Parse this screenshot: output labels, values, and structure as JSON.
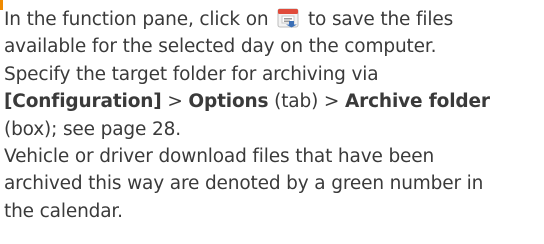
{
  "paragraph1": {
    "line1_before_icon": "In the function pane, click on",
    "icon": "archive-save-icon",
    "line1_after_icon": "to save the files",
    "line2": "available for the selected day on the computer."
  },
  "paragraph2": {
    "line1": "Specify the target folder for archiving via",
    "configuration": "[Configuration]",
    "sep1": " > ",
    "options": "Options",
    "tab": " (tab) > ",
    "archive_folder": "Archive folder",
    "box_line": "(box); see page 28."
  },
  "paragraph3": {
    "line1": "Vehicle or driver download files that have been",
    "line2": "archived this way are denoted by a green number in",
    "line3": "the calendar."
  },
  "colors": {
    "accent": "#f08a00",
    "icon_red": "#e04a3a",
    "icon_blue": "#3b6fb6",
    "text": "#3a3a3a"
  }
}
